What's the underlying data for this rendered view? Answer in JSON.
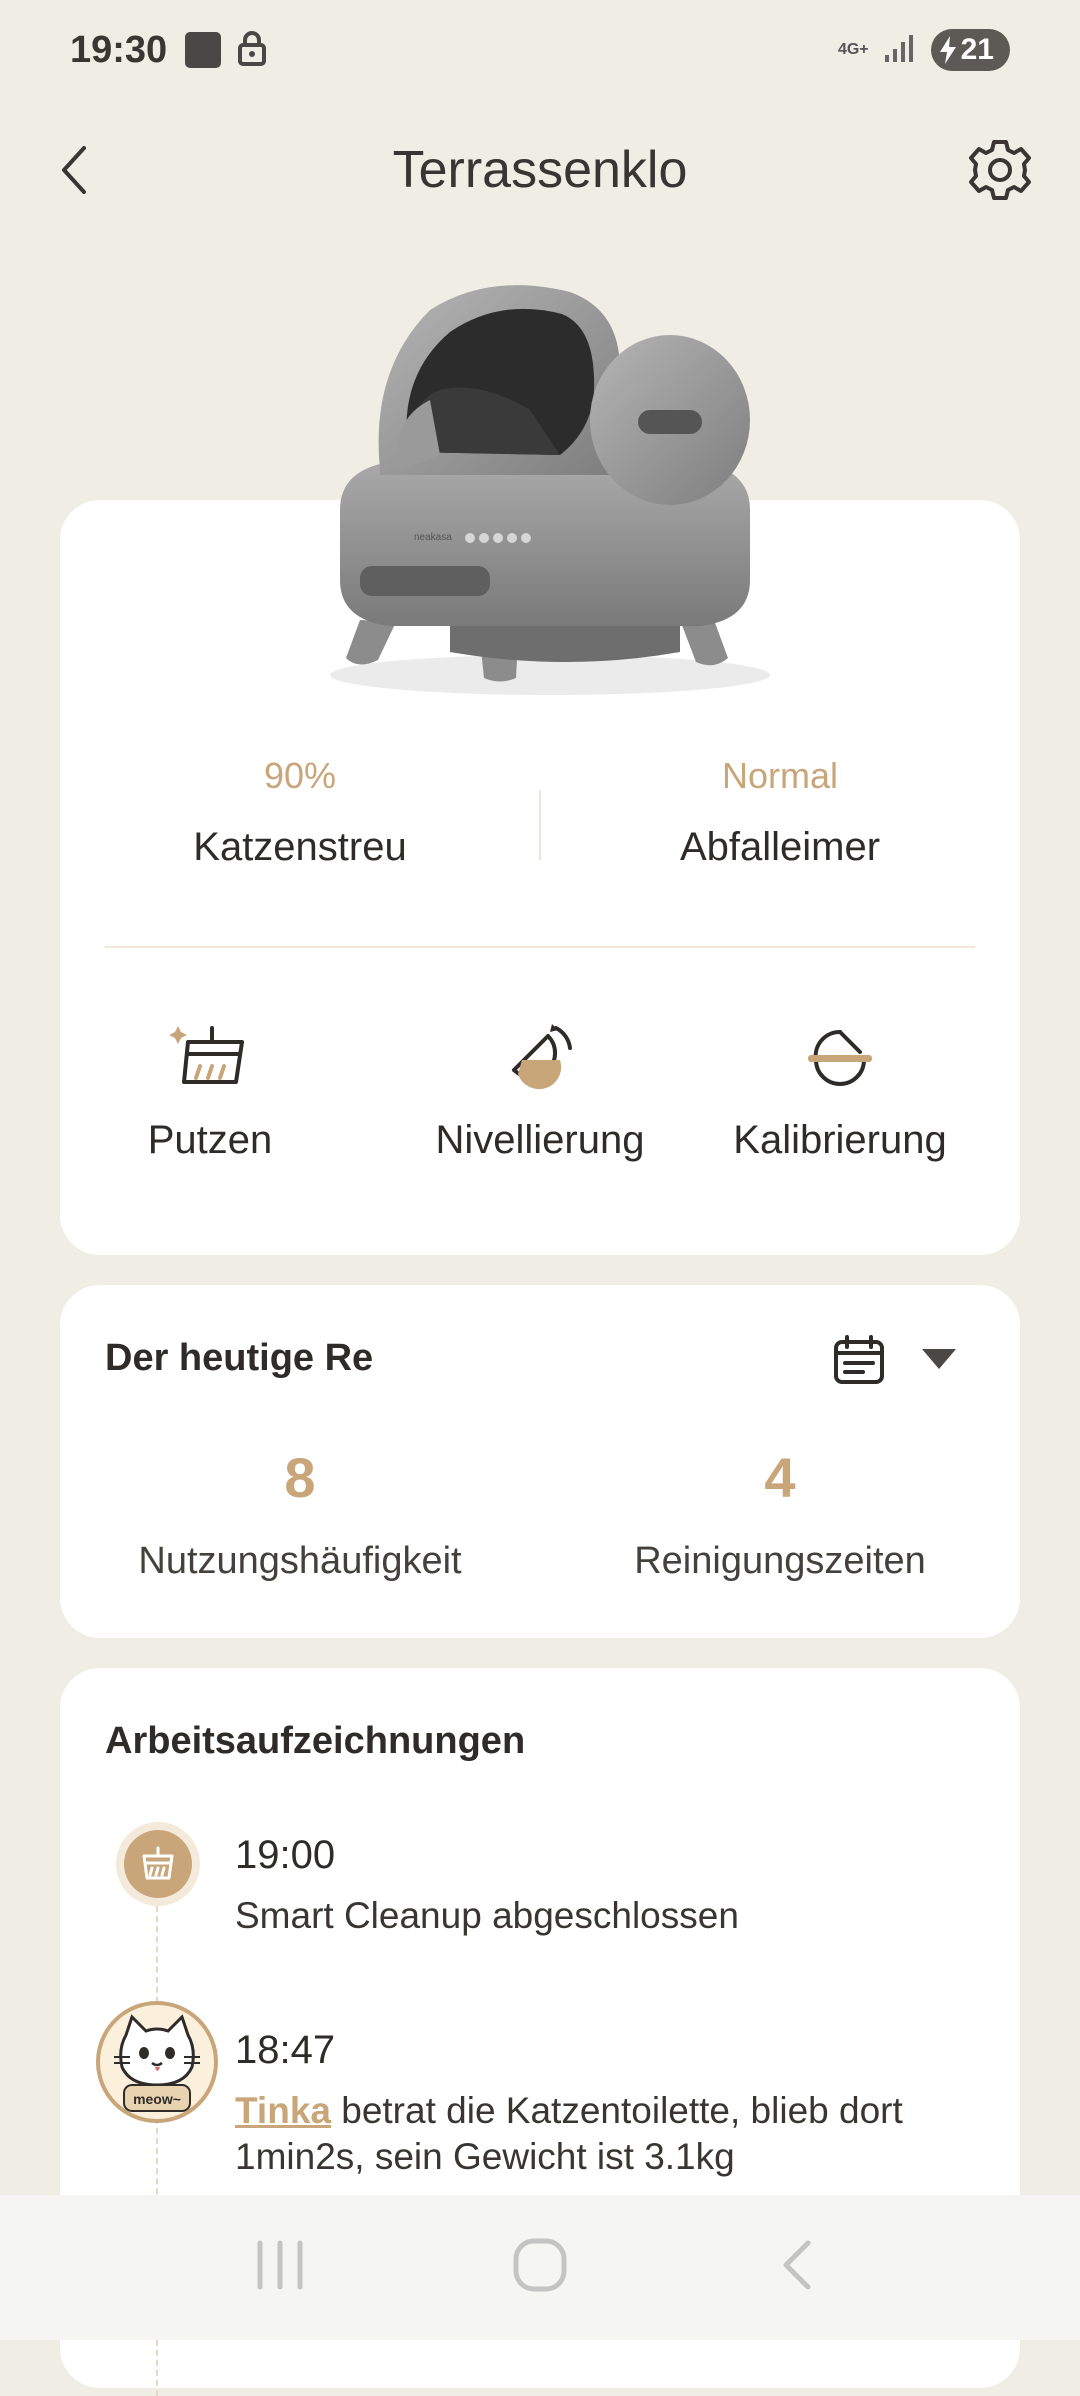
{
  "status_bar": {
    "time": "19:30",
    "network": "4G+",
    "battery": "21"
  },
  "header": {
    "title": "Terrassenklo"
  },
  "stats": [
    {
      "value": "90%",
      "label": "Katzenstreu"
    },
    {
      "value": "Normal",
      "label": "Abfalleimer"
    }
  ],
  "actions": [
    {
      "label": "Putzen",
      "icon": "broom-icon"
    },
    {
      "label": "Nivellierung",
      "icon": "leveling-icon"
    },
    {
      "label": "Kalibrierung",
      "icon": "calibration-icon"
    }
  ],
  "today": {
    "title": "Der heutige Re",
    "usage_count": "8",
    "usage_label": "Nutzungshäufigkeit",
    "clean_count": "4",
    "clean_label": "Reinigungszeiten"
  },
  "records": {
    "title": "Arbeitsaufzeichnungen",
    "entries": [
      {
        "time": "19:00",
        "text": "Smart Cleanup abgeschlossen"
      },
      {
        "time": "18:47",
        "cat": "Tinka",
        "text": " betrat die Katzentoilette, blieb dort 1min2s, sein Gewicht ist 3.1kg",
        "avatar_text": "meow~"
      }
    ]
  },
  "colors": {
    "accent": "#C9A57A",
    "background": "#F0EDE5"
  }
}
